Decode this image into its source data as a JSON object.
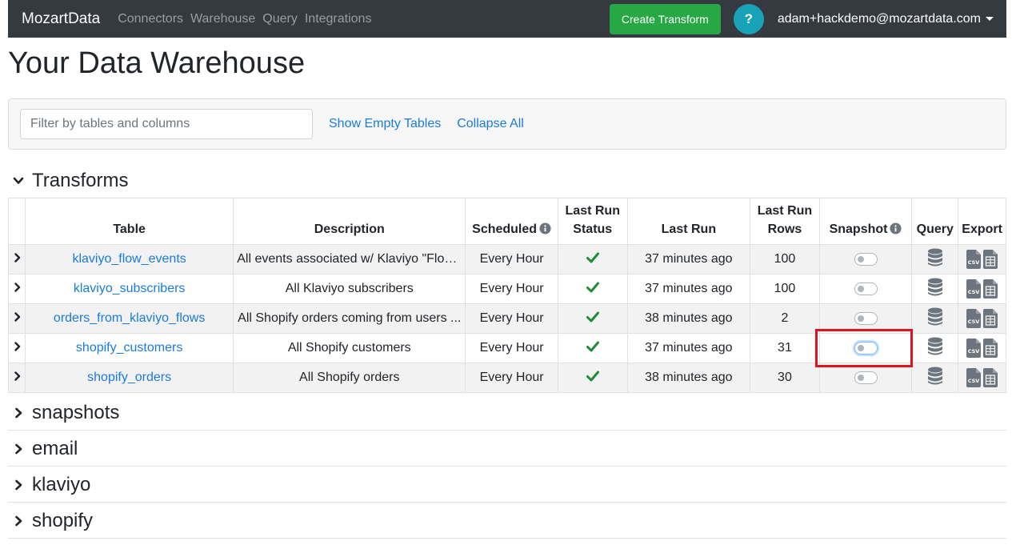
{
  "navbar": {
    "brand": "MozartData",
    "links": [
      "Connectors",
      "Warehouse",
      "Query",
      "Integrations"
    ],
    "create_button": "Create Transform",
    "help_label": "?",
    "user_email": "adam+hackdemo@mozartdata.com"
  },
  "page": {
    "title": "Your Data Warehouse"
  },
  "filter": {
    "placeholder": "Filter by tables and columns",
    "show_empty": "Show Empty Tables",
    "collapse_all": "Collapse All"
  },
  "sections": {
    "transforms": "Transforms",
    "snapshots": "snapshots",
    "email": "email",
    "klaviyo": "klaviyo",
    "shopify": "shopify"
  },
  "table": {
    "headers": {
      "table": "Table",
      "description": "Description",
      "scheduled": "Scheduled",
      "last_run_status_1": "Last Run",
      "last_run_status_2": "Status",
      "last_run": "Last Run",
      "last_run_rows_1": "Last Run",
      "last_run_rows_2": "Rows",
      "snapshot": "Snapshot",
      "query": "Query",
      "export": "Export"
    },
    "rows": [
      {
        "name": "klaviyo_flow_events",
        "description": "All events associated w/ Klaviyo \"Flows\"",
        "scheduled": "Every Hour",
        "last_run": "37 minutes ago",
        "rows": "100"
      },
      {
        "name": "klaviyo_subscribers",
        "description": "All Klaviyo subscribers",
        "scheduled": "Every Hour",
        "last_run": "37 minutes ago",
        "rows": "100"
      },
      {
        "name": "orders_from_klaviyo_flows",
        "description": "All Shopify orders coming from users ...",
        "scheduled": "Every Hour",
        "last_run": "38 minutes ago",
        "rows": "2"
      },
      {
        "name": "shopify_customers",
        "description": "All Shopify customers",
        "scheduled": "Every Hour",
        "last_run": "37 minutes ago",
        "rows": "31"
      },
      {
        "name": "shopify_orders",
        "description": "All Shopify orders",
        "scheduled": "Every Hour",
        "last_run": "38 minutes ago",
        "rows": "30"
      }
    ]
  },
  "colors": {
    "navbar_bg": "#343a40",
    "create_green": "#28a745",
    "help_teal": "#17a2b8",
    "link_blue": "#1a7be0",
    "check_green": "#1f8b3a",
    "highlight_red": "#e0141e"
  },
  "icons": {
    "section_toggle": "chevron-icon",
    "info": "info-circle-icon",
    "status": "checkmark-icon",
    "query": "database-icon",
    "export_csv": "csv-file-icon",
    "export_table": "table-file-icon"
  }
}
